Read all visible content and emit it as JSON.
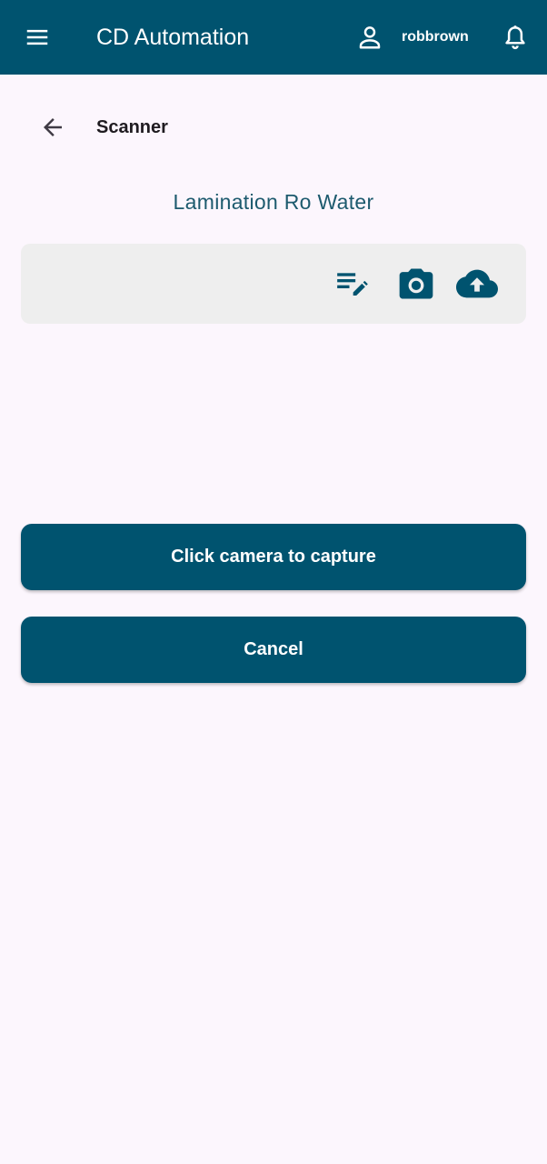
{
  "appbar": {
    "title": "CD Automation",
    "username": "robbrown",
    "icons": {
      "menu": "hamburger-menu-icon",
      "user": "person-outline-icon",
      "notifications": "bell-outline-icon"
    },
    "background_color": "#00536f"
  },
  "page": {
    "title": "Scanner",
    "back_icon": "arrow-back-icon",
    "subtitle": "Lamination Ro Water"
  },
  "toolbar": {
    "icons": [
      "edit-note-icon",
      "camera-icon",
      "cloud-upload-icon"
    ],
    "icon_color": "#00536f"
  },
  "actions": {
    "capture_label": "Click camera to capture",
    "cancel_label": "Cancel",
    "button_color": "#00536f"
  },
  "colors": {
    "background": "#fcf6fd",
    "card": "#eeeeee",
    "subtitle": "#1d5a6e"
  }
}
